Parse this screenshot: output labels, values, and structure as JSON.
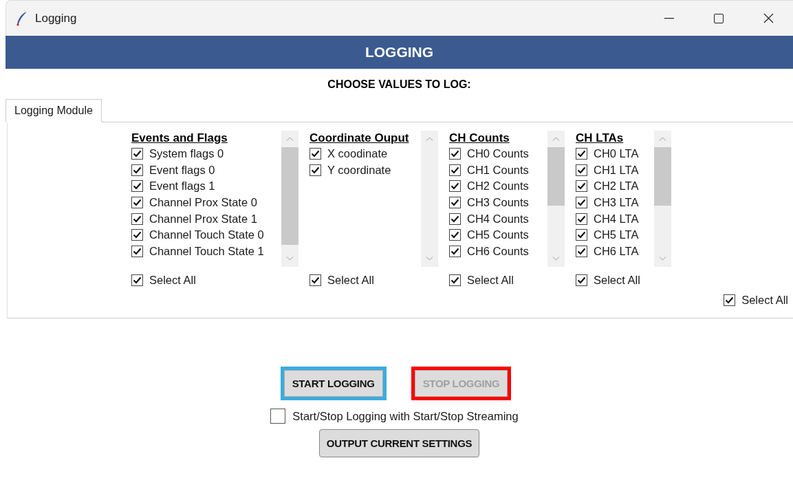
{
  "window": {
    "title": "Logging"
  },
  "banner": {
    "title": "LOGGING"
  },
  "subtitle": "CHOOSE VALUES TO LOG:",
  "tabs": [
    {
      "label": "Logging Module",
      "selected": true
    }
  ],
  "groups": [
    {
      "title": "Events and Flags",
      "items": [
        {
          "label": "System flags 0",
          "checked": true
        },
        {
          "label": "Event flags 0",
          "checked": true
        },
        {
          "label": "Event flags 1",
          "checked": true
        },
        {
          "label": "Channel Prox State 0",
          "checked": true
        },
        {
          "label": "Channel Prox State 1",
          "checked": true
        },
        {
          "label": "Channel Touch State 0",
          "checked": true
        },
        {
          "label": "Channel Touch State 1",
          "checked": true
        }
      ],
      "scrollable": true,
      "select_all": {
        "label": "Select All",
        "checked": true
      }
    },
    {
      "title": "Coordinate Ouput",
      "items": [
        {
          "label": "X coodinate",
          "checked": true
        },
        {
          "label": "Y coordinate",
          "checked": true
        }
      ],
      "scrollable": false,
      "select_all": {
        "label": "Select All",
        "checked": true
      }
    },
    {
      "title": "CH Counts",
      "items": [
        {
          "label": "CH0 Counts",
          "checked": true
        },
        {
          "label": "CH1 Counts",
          "checked": true
        },
        {
          "label": "CH2 Counts",
          "checked": true
        },
        {
          "label": "CH3 Counts",
          "checked": true
        },
        {
          "label": "CH4 Counts",
          "checked": true
        },
        {
          "label": "CH5 Counts",
          "checked": true
        },
        {
          "label": "CH6 Counts",
          "checked": true
        }
      ],
      "scrollable": true,
      "select_all": {
        "label": "Select All",
        "checked": true
      }
    },
    {
      "title": "CH LTAs",
      "items": [
        {
          "label": "CH0 LTA",
          "checked": true
        },
        {
          "label": "CH1 LTA",
          "checked": true
        },
        {
          "label": "CH2 LTA",
          "checked": true
        },
        {
          "label": "CH3 LTA",
          "checked": true
        },
        {
          "label": "CH4 LTA",
          "checked": true
        },
        {
          "label": "CH5 LTA",
          "checked": true
        },
        {
          "label": "CH6 LTA",
          "checked": true
        }
      ],
      "scrollable": true,
      "select_all": {
        "label": "Select All",
        "checked": true
      }
    }
  ],
  "select_all": {
    "label": "Select All",
    "checked": true
  },
  "buttons": [
    {
      "label": "START LOGGING",
      "disabled": false,
      "color": "#3aace0"
    },
    {
      "label": "STOP LOGGING",
      "disabled": true,
      "color": "#ff0000"
    }
  ],
  "sync_option": {
    "label": "Start/Stop Logging with Start/Stop Streaming",
    "checked": false
  },
  "output_button": {
    "label": "OUTPUT CURRENT SETTINGS"
  }
}
